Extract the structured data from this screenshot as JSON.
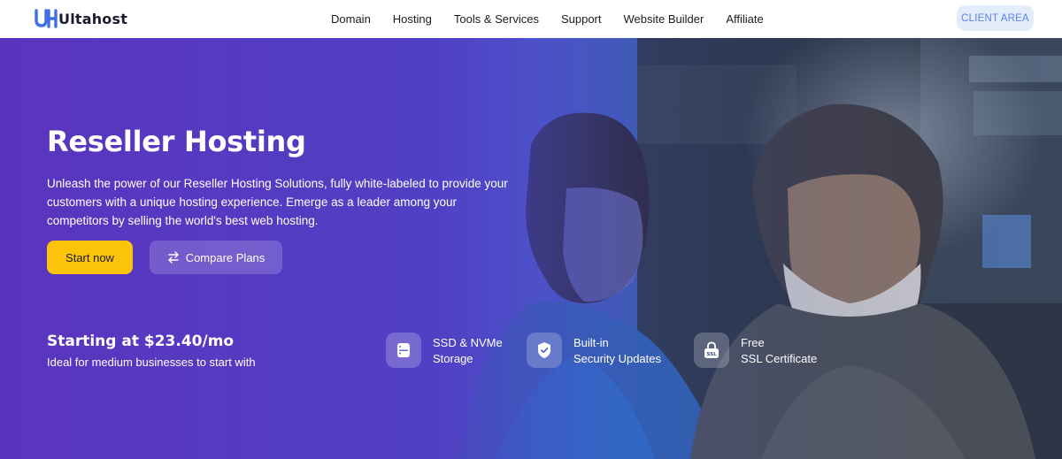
{
  "header": {
    "logo_text": "Ultahost",
    "nav": [
      "Domain",
      "Hosting",
      "Tools & Services",
      "Support",
      "Website Builder",
      "Affiliate"
    ],
    "client_button": "CLIENT AREA"
  },
  "hero": {
    "title": "Reseller Hosting",
    "description": "Unleash the power of our Reseller Hosting Solutions, fully white-labeled to provide your customers with a unique hosting experience. Emerge as a leader among your competitors by selling the world's best web hosting.",
    "start_button": "Start now",
    "compare_button": "Compare Plans",
    "price_line": "Starting at $23.40/mo",
    "price_sub": "Ideal for medium businesses to start with",
    "features": [
      {
        "icon": "server-icon",
        "line1": "SSD & NVMe",
        "line2": "Storage"
      },
      {
        "icon": "shield-check-icon",
        "line1": "Built-in",
        "line2": "Security Updates"
      },
      {
        "icon": "ssl-lock-icon",
        "line1": "Free",
        "line2": "SSL Certificate",
        "badge": "SSL"
      }
    ]
  },
  "colors": {
    "brand_blue": "#3f6fe6",
    "start_button": "#fcc30b",
    "client_button_bg": "#e3ecfb",
    "client_button_text": "#5d83e6",
    "hero_purple": "#5b34be"
  }
}
